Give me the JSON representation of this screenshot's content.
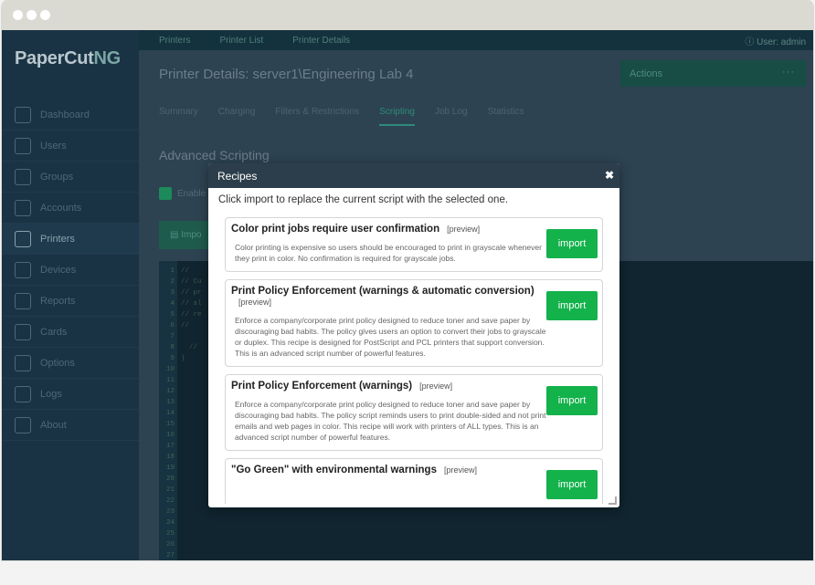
{
  "app": {
    "logo_main": "PaperCut",
    "logo_ng": "NG"
  },
  "breadcrumbs": [
    "Printers",
    "Printer List",
    "Printer Details"
  ],
  "user": "User: admin",
  "page_title": "Printer Details: server1\\Engineering Lab 4",
  "actions_label": "Actions",
  "tabs": [
    "Summary",
    "Charging",
    "Filters & Restrictions",
    "Scripting",
    "Job Log",
    "Statistics"
  ],
  "active_tab": "Scripting",
  "nav": [
    "Dashboard",
    "Users",
    "Groups",
    "Accounts",
    "Printers",
    "Devices",
    "Reports",
    "Cards",
    "Options",
    "Logs",
    "About"
  ],
  "active_nav": "Printers",
  "section_title": "Advanced Scripting",
  "enable_label": "Enable",
  "import_button_partial": "Impo",
  "editor": {
    "line_numbers": [
      "1",
      "2",
      "3",
      "4",
      "5",
      "6",
      "7",
      "8",
      "9",
      "10",
      "11",
      "12",
      "13",
      "14",
      "15",
      "16",
      "17",
      "18",
      "19",
      "20",
      "21",
      "22",
      "23",
      "24",
      "25",
      "26",
      "27"
    ],
    "code_lines": [
      "//",
      "// Cu",
      "// pr",
      "// al",
      "// re",
      "//",
      "",
      "  //",
      "}"
    ]
  },
  "modal": {
    "title": "Recipes",
    "intro": "Click import to replace the current script with the selected one.",
    "preview_label": "[preview]",
    "import_label": "import",
    "recipes": [
      {
        "title": "Color print jobs require user confirmation",
        "description": "Color printing is expensive so users should be encouraged to print in grayscale whenever they print in color. No confirmation is required for grayscale jobs."
      },
      {
        "title": "Print Policy Enforcement (warnings & automatic conversion)",
        "description": "Enforce a company/corporate print policy designed to reduce toner and save paper by discouraging bad habits. The policy gives users an option to convert their jobs to grayscale or duplex. This recipe is designed for PostScript and PCL printers that support conversion. This is an advanced script number of powerful features."
      },
      {
        "title": "Print Policy Enforcement (warnings)",
        "description": "Enforce a company/corporate print policy designed to reduce toner and save paper by discouraging bad habits. The policy script reminds users to print double-sided and not print emails and web pages in color. This recipe will work with printers of ALL types. This is an advanced script number of powerful features."
      },
      {
        "title": "\"Go Green\" with environmental warnings",
        "description": ""
      }
    ]
  }
}
